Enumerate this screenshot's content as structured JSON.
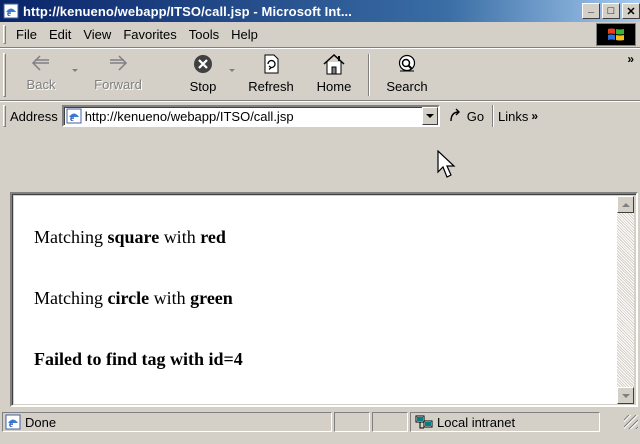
{
  "window": {
    "title": "http://kenueno/webapp/ITSO/call.jsp - Microsoft Int...",
    "minimize": "_",
    "maximize": "□",
    "close": "✕"
  },
  "menu": {
    "file": "File",
    "edit": "Edit",
    "view": "View",
    "favorites": "Favorites",
    "tools": "Tools",
    "help": "Help"
  },
  "toolbar": {
    "back": "Back",
    "forward": "Forward",
    "stop": "Stop",
    "refresh": "Refresh",
    "home": "Home",
    "search": "Search",
    "more": "»"
  },
  "address": {
    "label": "Address",
    "url": "http://kenueno/webapp/ITSO/call.jsp",
    "go": "Go",
    "links": "Links",
    "links_more": "»"
  },
  "content": {
    "line1": {
      "prefix": "Matching ",
      "shape": "square",
      "mid": " with ",
      "color": "red"
    },
    "line2": {
      "prefix": "Matching ",
      "shape": "circle",
      "mid": " with ",
      "color": "green"
    },
    "line3": "Failed to find tag with id=4"
  },
  "status": {
    "text": "Done",
    "zone": "Local intranet"
  },
  "colors": {
    "titlebar_start": "#0a246a",
    "titlebar_end": "#a6caf0",
    "chrome": "#d4d0c8"
  }
}
